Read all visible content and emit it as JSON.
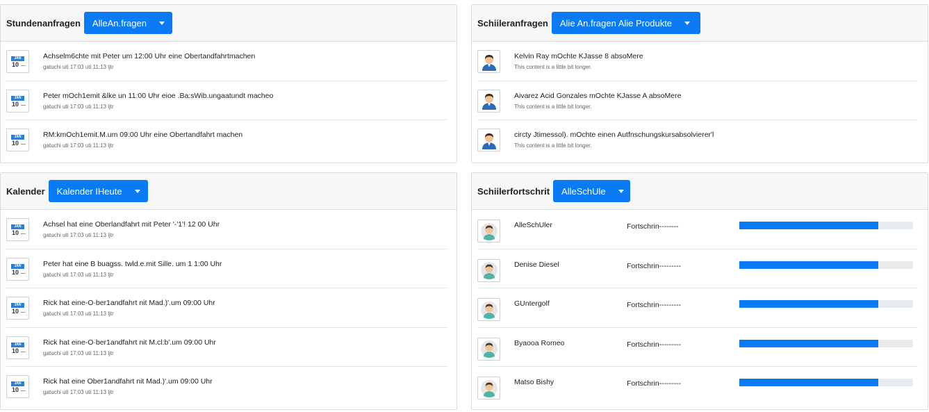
{
  "colors": {
    "accent": "#0a7bf5",
    "calendar_blue": "#2f7fd1",
    "header_bg": "#f7f7f7",
    "progress_track": "#e9ecef"
  },
  "stundenanfragen": {
    "title": "Stundenanfragen",
    "dropdown_label": "AlleAn.fragen",
    "items": [
      {
        "icon": "calendar-icon",
        "cal_month": "JAN",
        "cal_day": "10",
        "title": "Achselm6chte mit Peter um 12:00 Uhr eine Obertandfahrtmachen",
        "sub": "gatuchi uti 17:03 uti 11:13 ljtr"
      },
      {
        "icon": "calendar-icon",
        "cal_month": "JAN",
        "cal_day": "10",
        "title": "Peter mOch1emit &lke un 11:00 Uhr eioe .Ba:sWib.ungaatundt macheo",
        "sub": "gatuchi uti 17:03 uti 11:13 ljtr"
      },
      {
        "icon": "calendar-icon",
        "cal_month": "JAN",
        "cal_day": "10",
        "title": "RM:kmOch1emit.M.um 09:00 Uhr eine Obertandfahrt machen",
        "sub": "gatuchi uti 17:03 uti 11:13 ljtr"
      }
    ]
  },
  "schuleranfragen": {
    "title": "Schiileranfragen",
    "dropdown_label": "Alie An.fragen Alie Produkte",
    "items": [
      {
        "icon": "user-icon",
        "title": "Kelvin Ray mOchte KJasse 8 absoMere",
        "sub": "This content is a little bit longer."
      },
      {
        "icon": "user-icon",
        "title": "Aivarez Acid Gonzales mOchte KJasse A absoMere",
        "sub": "This content is a little bit longer."
      },
      {
        "icon": "user-icon",
        "title": "circty Jtimessol). mOchte einen Autfnschungskursabsolvierer'l",
        "sub": "This content is a little bit longer."
      }
    ]
  },
  "kalender": {
    "title": "Kalender",
    "dropdown_label": "Kalender IHeute",
    "items": [
      {
        "icon": "calendar-icon",
        "cal_month": "JAN",
        "cal_day": "10",
        "title": "Achsel hat eine Oberlandfahrt mit Peter '-'1'! 12 00 Uhr",
        "sub": "gatuchi uti 17:03 uti 11:13 ljtr"
      },
      {
        "icon": "calendar-icon",
        "cal_month": "JAN",
        "cal_day": "10",
        "title": "Peter hat eine B buagss. twld.e.mit Sille. um 1 1:00 Uhr",
        "sub": "gatuchi uti 17:03 uti 11:13 ljtr"
      },
      {
        "icon": "calendar-icon",
        "cal_month": "JAN",
        "cal_day": "10",
        "title": "Rick hat eine-O·ber1andfahrt nit Mad.)'.um 09:00 Uhr",
        "sub": "gatuchi uti 17:03 uti 11:13 ljtr"
      },
      {
        "icon": "calendar-icon",
        "cal_month": "JAN",
        "cal_day": "10",
        "title": "Rick hat eine-O·ber1andfahrt nit M.cl:b'.um 09:00 Uhr",
        "sub": "gatuchi uti 17:03 uti 11:13 ljtr"
      },
      {
        "icon": "calendar-icon",
        "cal_month": "JAN",
        "cal_day": "10",
        "title": "Rick hat eine Ober1andfahrt nit Mad.)'.um 09:00 Uhr",
        "sub": "gatuchi uti 17:03 uti 11:13 ljtr"
      }
    ]
  },
  "schulerfortschritt": {
    "title": "Schiilerfortschrit",
    "dropdown_label": "AlleSchUle",
    "items": [
      {
        "icon": "student-avatar-icon",
        "name": "AlleSchUler",
        "label": "Fortschrin--------",
        "progress": 0.8
      },
      {
        "icon": "student-avatar-icon",
        "name": "Denise Diesel",
        "label": "Fortschrin---------",
        "progress": 0.8
      },
      {
        "icon": "student-avatar-icon",
        "name": "GUntergolf",
        "label": "Fortschrin---------",
        "progress": 0.8
      },
      {
        "icon": "student-avatar-icon",
        "name": "Byaooa Romeo",
        "label": "Fortschrin---------",
        "progress": 0.8
      },
      {
        "icon": "student-avatar-icon",
        "name": "Matso Bishy",
        "label": "Fortschrin---------",
        "progress": 0.8
      }
    ]
  }
}
